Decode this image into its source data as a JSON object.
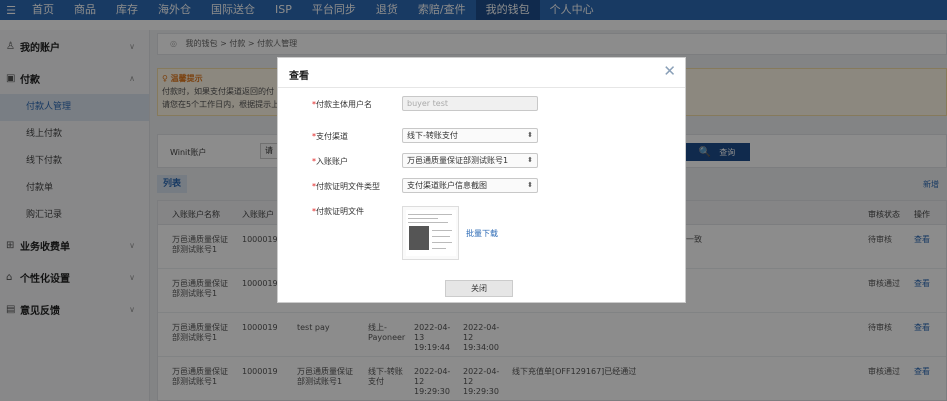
{
  "topnav": {
    "menu_icon": "menu-icon",
    "items": [
      "首页",
      "商品",
      "库存",
      "海外仓",
      "国际送仓",
      "ISP",
      "平台同步",
      "退货",
      "索赔/查件",
      "我的钱包",
      "个人中心"
    ],
    "active_index": 9
  },
  "sidebar": {
    "groups": [
      {
        "icon": "user-icon",
        "label": "我的账户"
      },
      {
        "icon": "payment-icon",
        "label": "付款",
        "sub": [
          "付款人管理",
          "线上付款",
          "线下付款",
          "付款单",
          "购汇记录"
        ]
      },
      {
        "icon": "business-icon",
        "label": "业务收费单"
      },
      {
        "icon": "settings-icon",
        "label": "个性化设置"
      },
      {
        "icon": "feedback-icon",
        "label": "意见反馈"
      }
    ],
    "active_sub": "付款人管理"
  },
  "breadcrumb": "我的钱包 > 付款 > 付款人管理",
  "tips": {
    "title": "温馨提示",
    "line1": "付款时，如果支付渠道返回的付",
    "line2": "请您在5个工作日内，根据提示上"
  },
  "filter": {
    "label": "Winit账户",
    "select_text": "请",
    "query_label": "查询"
  },
  "list": {
    "tab": "列表",
    "new_label": "新增"
  },
  "table": {
    "headers": {
      "account_name": "入账账户名称",
      "account_no": "入账账户",
      "review_status": "审核状态",
      "action": "操作"
    },
    "rows": [
      {
        "name": "万邑通质量保证部测试账号1",
        "no": "1000019",
        "remark": "一致",
        "status": "待审核",
        "action": "查看"
      },
      {
        "name": "万邑通质量保证部测试账号1",
        "no": "1000019",
        "status": "审核通过",
        "action": "查看"
      },
      {
        "name": "万邑通质量保证部测试账号1",
        "no": "1000019",
        "payer": "test pay",
        "channel": "线上-Payoneer",
        "date1": "2022-04-13 19:19:44",
        "date2": "2022-04-12 19:34:00",
        "status": "待审核",
        "action": "查看"
      },
      {
        "name": "万邑通质量保证部测试账号1",
        "no": "1000019",
        "payer": "万邑通质量保证部测试账号1",
        "channel": "线下-转账支付",
        "date1": "2022-04-12 19:29:30",
        "date2": "2022-04-12 19:29:30",
        "remark": "线下充值单[OFF129167]已经通过",
        "status": "审核通过",
        "action": "查看"
      }
    ]
  },
  "modal": {
    "title": "查看",
    "fields": {
      "payer_name_label": "付款主体用户名",
      "payer_name_value": "buyer test",
      "channel_label": "支付渠道",
      "channel_value": "线下-转账支付",
      "account_label": "入账账户",
      "account_value": "万邑通质量保证部测试账号1",
      "proof_type_label": "付款证明文件类型",
      "proof_type_value": "支付渠道账户信息截图",
      "proof_file_label": "付款证明文件"
    },
    "required_mark": "*",
    "batch_download": "批量下载",
    "close_button": "关闭"
  }
}
